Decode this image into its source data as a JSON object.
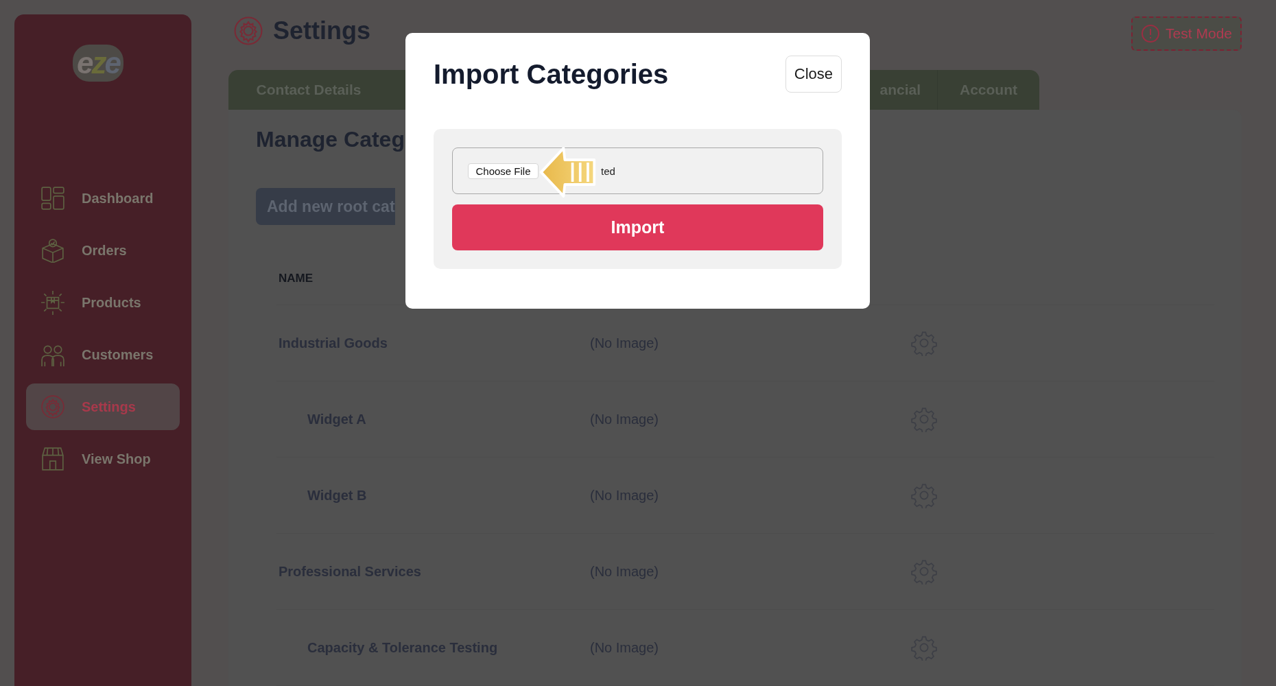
{
  "sidebar": {
    "logo": "eze",
    "items": [
      {
        "label": "Dashboard",
        "selected": false
      },
      {
        "label": "Orders",
        "selected": false
      },
      {
        "label": "Products",
        "selected": false
      },
      {
        "label": "Customers",
        "selected": false
      },
      {
        "label": "Settings",
        "selected": true
      },
      {
        "label": "View Shop",
        "selected": false
      }
    ]
  },
  "header": {
    "title": "Settings",
    "test_mode": "Test Mode"
  },
  "tabs": [
    {
      "label": "Contact Details"
    },
    {
      "label": "ancial"
    },
    {
      "label": "Account"
    }
  ],
  "panel": {
    "title": "Manage Categ",
    "add_button": "Add new root cat",
    "table": {
      "columns": [
        "NAME"
      ],
      "rows": [
        {
          "name": "Industrial Goods",
          "image": "(No Image)",
          "children": [
            {
              "name": "Widget A",
              "image": "(No Image)"
            },
            {
              "name": "Widget B",
              "image": "(No Image)"
            }
          ]
        },
        {
          "name": "Professional Services",
          "image": "(No Image)",
          "children": [
            {
              "name": "Capacity & Tolerance Testing",
              "image": "(No Image)"
            }
          ]
        }
      ]
    }
  },
  "modal": {
    "title": "Import Categories",
    "close": "Close",
    "file_button": "Choose File",
    "file_status": "ted",
    "import_button": "Import"
  }
}
